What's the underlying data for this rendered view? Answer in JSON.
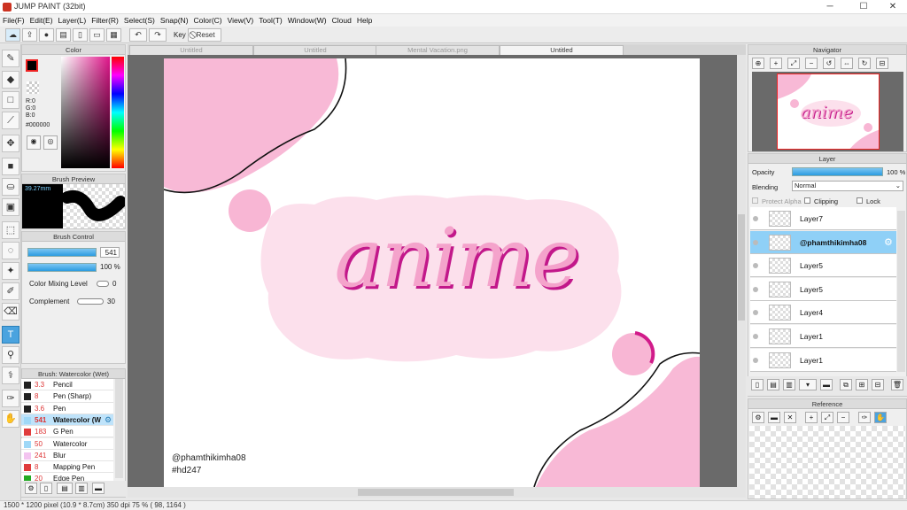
{
  "window": {
    "title": "JUMP PAINT (32bit)"
  },
  "menu": [
    "File(F)",
    "Edit(E)",
    "Layer(L)",
    "Filter(R)",
    "Select(S)",
    "Snap(N)",
    "Color(C)",
    "View(V)",
    "Tool(T)",
    "Window(W)",
    "Cloud",
    "Help"
  ],
  "toolbar": {
    "key_label": "Key",
    "reset_label": "Reset"
  },
  "doc_tabs": [
    "Untitled",
    "Untitled",
    "Mental Vacation.png",
    "Untitled"
  ],
  "color_panel": {
    "title": "Color",
    "r": "R:0",
    "g": "G:0",
    "b": "B:0",
    "hex": "#000000"
  },
  "brush_preview": {
    "title": "Brush Preview",
    "size": "39.27mm"
  },
  "brush_control": {
    "title": "Brush Control",
    "size": "541",
    "opacity": "100 %",
    "mixing_label": "Color Mixing Level",
    "mixing_value": "0",
    "complement_label": "Complement",
    "complement_value": "30"
  },
  "brush_list": {
    "title": "Brush: Watercolor (Wet)",
    "items": [
      {
        "size": "3.3",
        "name": "Pencil",
        "color": "#222222"
      },
      {
        "size": "8",
        "name": "Pen (Sharp)",
        "color": "#222222"
      },
      {
        "size": "3.6",
        "name": "Pen",
        "color": "#222222"
      },
      {
        "size": "541",
        "name": "Watercolor (W",
        "color": "#9fd8f7"
      },
      {
        "size": "183",
        "name": "G Pen",
        "color": "#e03c3c"
      },
      {
        "size": "50",
        "name": "Watercolor",
        "color": "#9fd8f7"
      },
      {
        "size": "241",
        "name": "Blur",
        "color": "#f3c4f0"
      },
      {
        "size": "8",
        "name": "Mapping Pen",
        "color": "#e03c3c"
      },
      {
        "size": "20",
        "name": "Edge Pen",
        "color": "#22aa22"
      }
    ]
  },
  "canvas": {
    "credit": "@phamthikimha08",
    "tag": "#hd247",
    "word": "anime"
  },
  "navigator": {
    "title": "Navigator"
  },
  "layer_panel": {
    "title": "Layer",
    "opacity_label": "Opacity",
    "opacity_value": "100 %",
    "blending_label": "Blending",
    "blending_value": "Normal",
    "protect_alpha": "Protect Alpha",
    "clipping": "Clipping",
    "lock": "Lock",
    "layers": [
      "Layer7",
      "@phamthikimha08",
      "Layer5",
      "Layer5",
      "Layer4",
      "Layer1",
      "Layer1"
    ]
  },
  "reference": {
    "title": "Reference"
  },
  "status": {
    "text": "1500 * 1200 pixel   (10.9 * 8.7cm)   350 dpi   75 %   ( 98, 1164 )"
  }
}
